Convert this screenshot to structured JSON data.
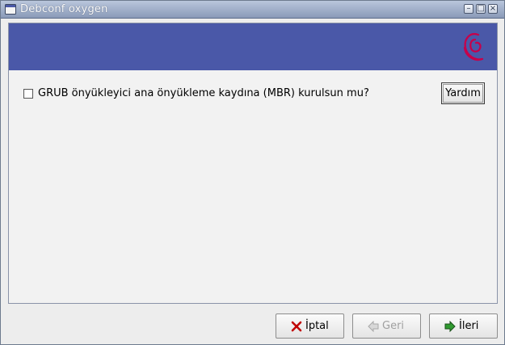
{
  "window": {
    "title": "Debconf oxygen"
  },
  "titlebar_buttons": {
    "minimize": "–",
    "maximize": "□",
    "close": "×"
  },
  "question": {
    "checked": false,
    "label": "GRUB önyükleyici ana önyükleme kaydına (MBR) kurulsun mu?"
  },
  "help_button": {
    "label": "Yardım"
  },
  "footer": {
    "cancel_label": "İptal",
    "back_label": "Geri",
    "back_enabled": false,
    "next_label": "İleri"
  },
  "colors": {
    "banner": "#4a58a8",
    "logo": "#c7004a"
  },
  "icons": {
    "cancel": "x-icon",
    "back": "arrow-left-icon",
    "next": "arrow-right-icon",
    "logo": "debian-swirl-icon"
  }
}
